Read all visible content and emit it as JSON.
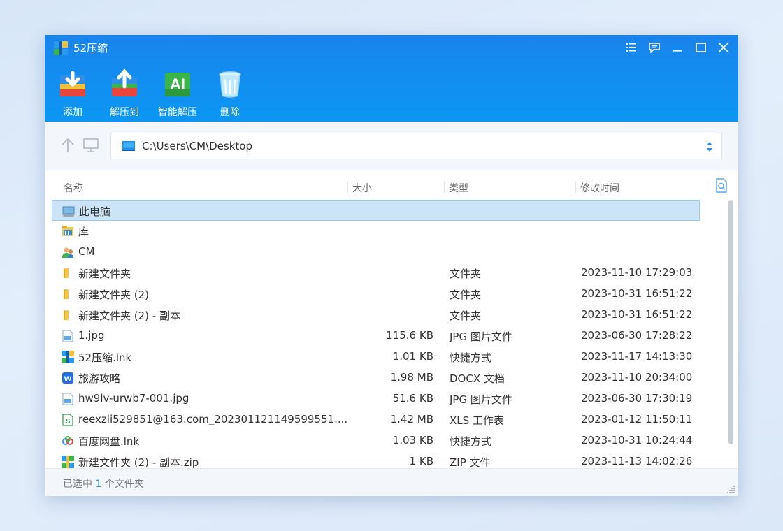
{
  "app": {
    "title": "52压缩"
  },
  "toolbar": {
    "add": "添加",
    "extract_to": "解压到",
    "smart_extract": "智能解压",
    "delete": "删除"
  },
  "nav": {
    "path": "C:\\Users\\CM\\Desktop"
  },
  "columns": {
    "name": "名称",
    "size": "大小",
    "type": "类型",
    "modified": "修改时间"
  },
  "files": [
    {
      "name": "此电脑",
      "size": "",
      "type": "",
      "modified": "",
      "icon": "computer-icon",
      "selected": true
    },
    {
      "name": "库",
      "size": "",
      "type": "",
      "modified": "",
      "icon": "library-icon"
    },
    {
      "name": "CM",
      "size": "",
      "type": "",
      "modified": "",
      "icon": "user-folder-icon"
    },
    {
      "name": "新建文件夹",
      "size": "",
      "type": "文件夹",
      "modified": "2023-11-10 17:29:03",
      "icon": "folder-icon"
    },
    {
      "name": "新建文件夹 (2)",
      "size": "",
      "type": "文件夹",
      "modified": "2023-10-31 16:51:22",
      "icon": "folder-icon"
    },
    {
      "name": "新建文件夹 (2) - 副本",
      "size": "",
      "type": "文件夹",
      "modified": "2023-10-31 16:51:22",
      "icon": "folder-icon"
    },
    {
      "name": "1.jpg",
      "size": "115.6 KB",
      "type": "JPG 图片文件",
      "modified": "2023-06-30 17:28:22",
      "icon": "image-file-icon"
    },
    {
      "name": "52压缩.lnk",
      "size": "1.01 KB",
      "type": "快捷方式",
      "modified": "2023-11-17 14:13:30",
      "icon": "archive-app-icon"
    },
    {
      "name": "旅游攻略",
      "size": "1.98 MB",
      "type": "DOCX 文档",
      "modified": "2023-11-10 20:34:00",
      "icon": "word-doc-icon"
    },
    {
      "name": "hw9lv-urwb7-001.jpg",
      "size": "51.6 KB",
      "type": "JPG 图片文件",
      "modified": "2023-06-30 17:30:19",
      "icon": "image-file-icon"
    },
    {
      "name": "reexzli529851@163.com_202301121149599551....",
      "size": "1.42 MB",
      "type": "XLS 工作表",
      "modified": "2023-01-12 11:50:11",
      "icon": "spreadsheet-icon"
    },
    {
      "name": "百度网盘.lnk",
      "size": "1.03 KB",
      "type": "快捷方式",
      "modified": "2023-10-31 10:24:44",
      "icon": "cloud-drive-icon"
    },
    {
      "name": "新建文件夹 (2) - 副本.zip",
      "size": "1 KB",
      "type": "ZIP 文件",
      "modified": "2023-11-13 14:02:26",
      "icon": "zip-file-icon"
    }
  ],
  "status": {
    "prefix": "已选中",
    "count": "1",
    "suffix": "个文件夹"
  },
  "colors": {
    "header": "#1a84ec",
    "selection": "#cce4f7",
    "accent": "#2a8ee8"
  }
}
